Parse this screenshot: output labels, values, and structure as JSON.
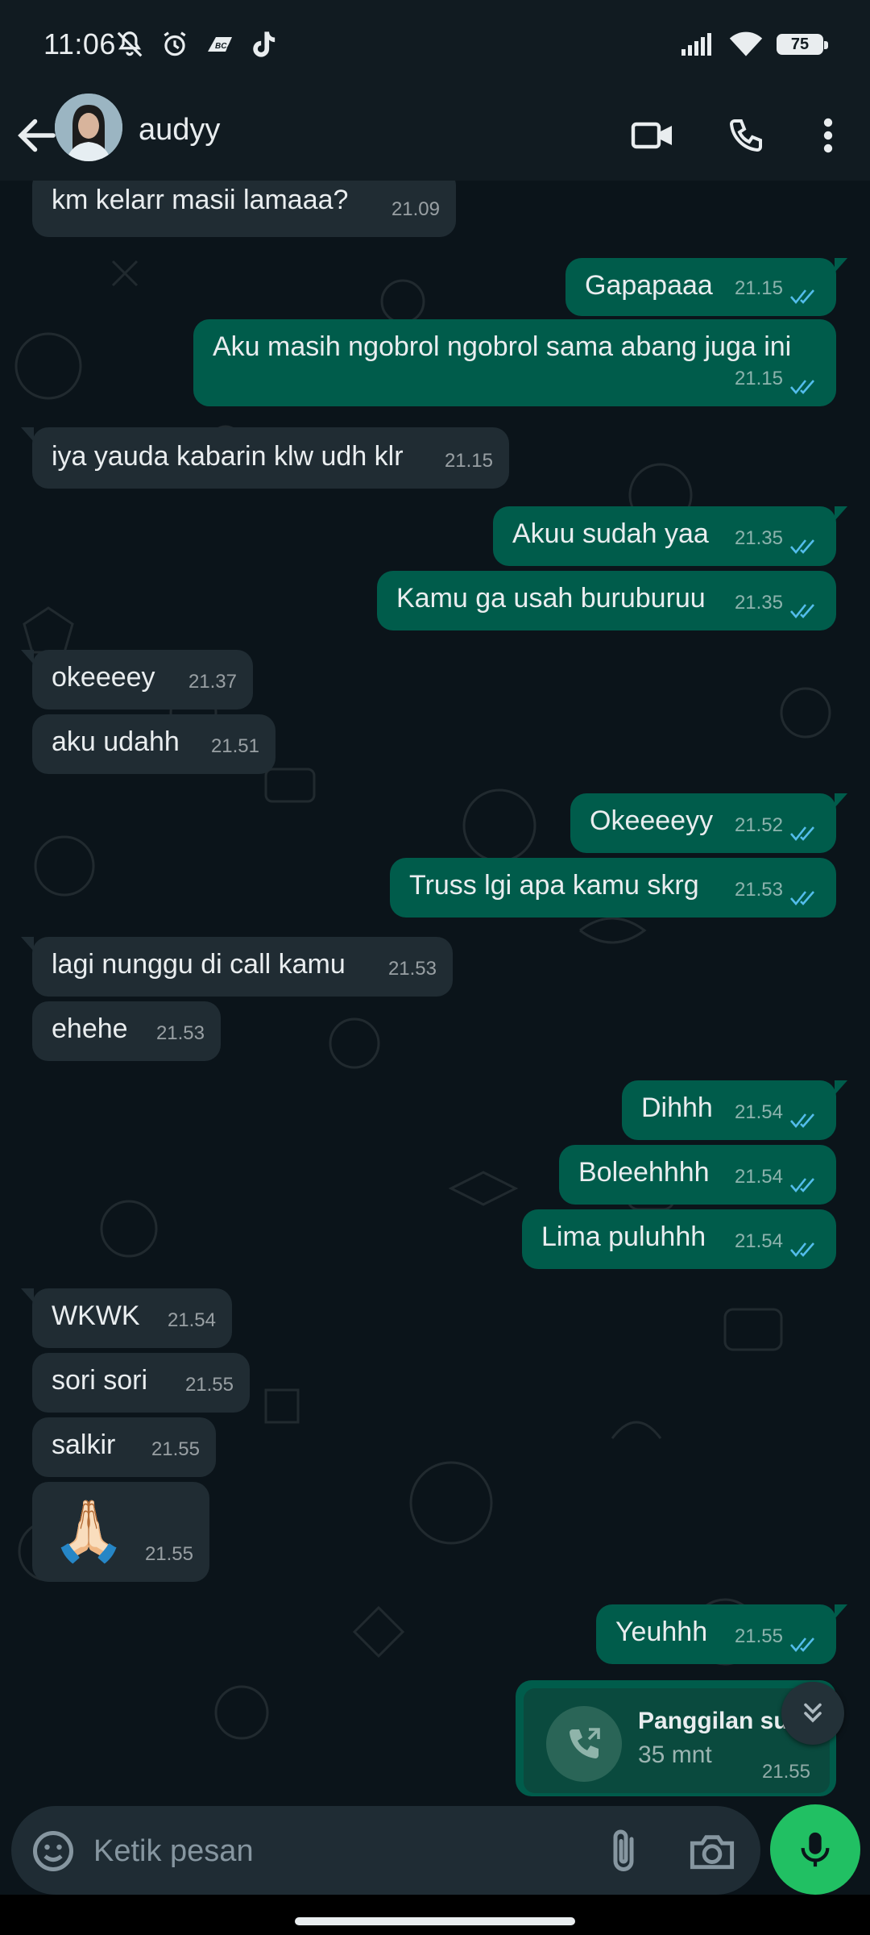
{
  "status_bar": {
    "time": "11:06",
    "battery": "75"
  },
  "header": {
    "contact_name": "audyy"
  },
  "messages": [
    {
      "dir": "in",
      "text": "km kelarr masii lamaaa?",
      "time": "21.09"
    },
    {
      "dir": "out",
      "text": "Gapapaaa",
      "time": "21.15",
      "read": true
    },
    {
      "dir": "out",
      "text": "Aku masih ngobrol ngobrol sama abang juga ini",
      "time": "21.15",
      "read": true
    },
    {
      "dir": "in",
      "text": "iya yauda kabarin klw udh klr",
      "time": "21.15"
    },
    {
      "dir": "out",
      "text": "Akuu sudah yaa",
      "time": "21.35",
      "read": true
    },
    {
      "dir": "out",
      "text": "Kamu ga usah buruburuu",
      "time": "21.35",
      "read": true
    },
    {
      "dir": "in",
      "text": "okeeeey",
      "time": "21.37"
    },
    {
      "dir": "in",
      "text": "aku udahh",
      "time": "21.51"
    },
    {
      "dir": "out",
      "text": "Okeeeeyy",
      "time": "21.52",
      "read": true
    },
    {
      "dir": "out",
      "text": "Truss lgi apa kamu skrg",
      "time": "21.53",
      "read": true
    },
    {
      "dir": "in",
      "text": "lagi nunggu di call kamu",
      "time": "21.53"
    },
    {
      "dir": "in",
      "text": "ehehe",
      "time": "21.53"
    },
    {
      "dir": "out",
      "text": "Dihhh",
      "time": "21.54",
      "read": true
    },
    {
      "dir": "out",
      "text": "Boleehhhh",
      "time": "21.54",
      "read": true
    },
    {
      "dir": "out",
      "text": "Lima puluhhh",
      "time": "21.54",
      "read": true
    },
    {
      "dir": "in",
      "text": "WKWK",
      "time": "21.54"
    },
    {
      "dir": "in",
      "text": "sori sori",
      "time": "21.55"
    },
    {
      "dir": "in",
      "text": "salkir",
      "time": "21.55"
    },
    {
      "dir": "in",
      "text": "🙏🏻",
      "time": "21.55",
      "emoji": true
    },
    {
      "dir": "out",
      "text": "Yeuhhh",
      "time": "21.55",
      "read": true
    }
  ],
  "call_message": {
    "title": "Panggilan sua",
    "duration": "35 mnt",
    "time": "21.55"
  },
  "composer": {
    "placeholder": "Ketik pesan"
  },
  "colors": {
    "header_bg": "#111b21",
    "chat_bg": "#0b141a",
    "incoming": "#202c33",
    "outgoing": "#005c4b",
    "read_ticks": "#53bdeb",
    "mic_green": "#21c063"
  }
}
